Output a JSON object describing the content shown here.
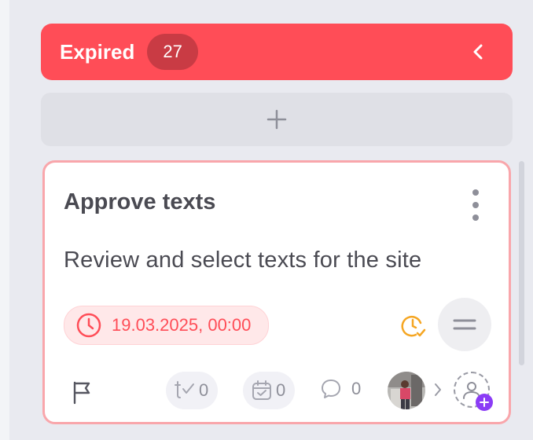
{
  "column": {
    "title": "Expired",
    "count": "27",
    "color": "#ff4d57",
    "collapse_icon": "chevron-left-icon",
    "add_icon": "plus-icon"
  },
  "card": {
    "title": "Approve texts",
    "description": "Review and select texts for the site",
    "deadline": "19.03.2025, 00:00",
    "subtasks_count": "0",
    "checklist_count": "0",
    "comments_count": "0",
    "border_color": "#f9a6ab"
  }
}
